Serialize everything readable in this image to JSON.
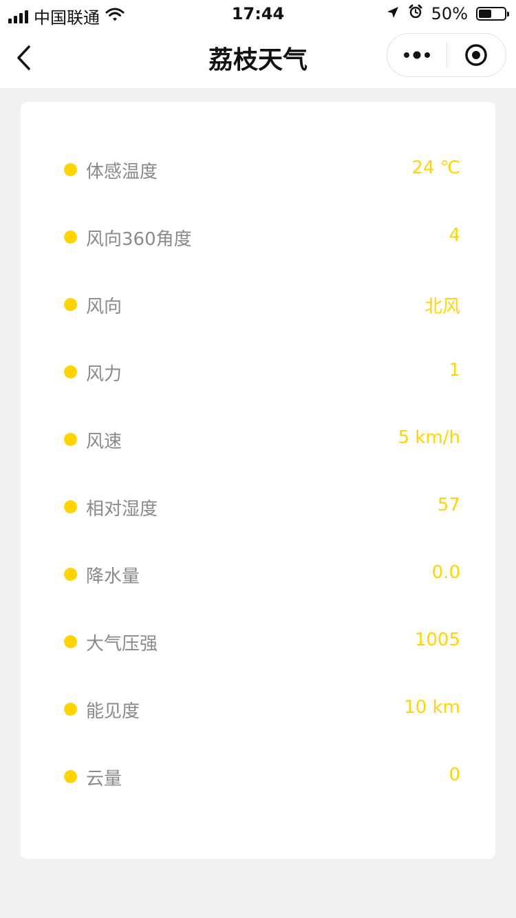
{
  "status_bar": {
    "carrier": "中国联通",
    "time": "17:44",
    "battery_percent": "50%",
    "battery_level": 0.5,
    "icons": [
      "signal-icon",
      "wifi-icon",
      "location-arrow-icon",
      "alarm-icon",
      "battery-icon"
    ]
  },
  "nav": {
    "title": "荔枝天气",
    "icons": [
      "back-chevron-icon",
      "more-dots-icon",
      "close-target-icon"
    ]
  },
  "colors": {
    "accent": "#ffd400",
    "label": "#8a8a8a",
    "background": "#f1f1f1"
  },
  "details": [
    {
      "label": "体感温度",
      "value": "24 ℃"
    },
    {
      "label": "风向360角度",
      "value": "4"
    },
    {
      "label": "风向",
      "value": "北风"
    },
    {
      "label": "风力",
      "value": "1"
    },
    {
      "label": "风速",
      "value": "5 km/h"
    },
    {
      "label": "相对湿度",
      "value": "57"
    },
    {
      "label": "降水量",
      "value": "0.0"
    },
    {
      "label": "大气压强",
      "value": "1005"
    },
    {
      "label": "能见度",
      "value": "10 km"
    },
    {
      "label": "云量",
      "value": "0"
    }
  ]
}
